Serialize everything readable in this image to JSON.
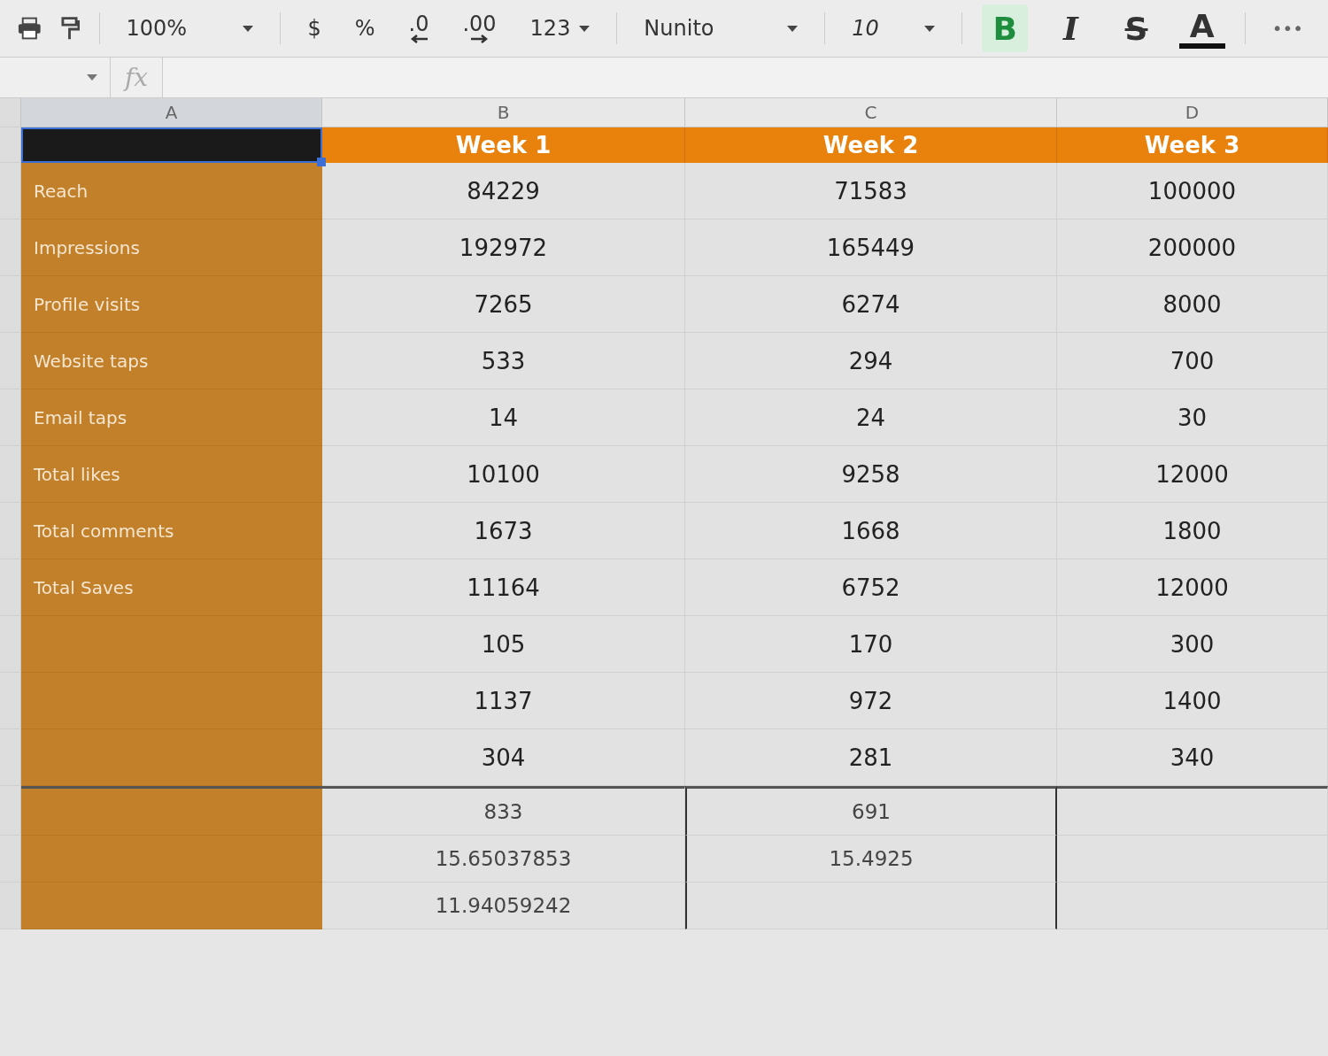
{
  "toolbar": {
    "zoom": "100%",
    "currency": "$",
    "percent": "%",
    "decrease_decimals": ".0",
    "increase_decimals": ".00",
    "more_formats": "123",
    "font": "Nunito",
    "font_size": "10",
    "format_buttons": [
      {
        "kind": "bold",
        "label": "B",
        "selected": true
      },
      {
        "kind": "italic",
        "label": "I",
        "selected": false
      },
      {
        "kind": "strike",
        "label": "S",
        "selected": false
      },
      {
        "kind": "color",
        "label": "A",
        "selected": false
      }
    ],
    "more": "•••"
  },
  "formula_bar": {
    "fx": "fx"
  },
  "columns": [
    "A",
    "B",
    "C",
    "D"
  ],
  "header_row": [
    "Week 1",
    "Week 2",
    "Week 3"
  ],
  "rows": [
    {
      "label": "Reach",
      "values": [
        "84229",
        "71583",
        "100000"
      ]
    },
    {
      "label": "Impressions",
      "values": [
        "192972",
        "165449",
        "200000"
      ]
    },
    {
      "label": "Profile visits",
      "values": [
        "7265",
        "6274",
        "8000"
      ]
    },
    {
      "label": "Website taps",
      "values": [
        "533",
        "294",
        "700"
      ]
    },
    {
      "label": "Email taps",
      "values": [
        "14",
        "24",
        "30"
      ]
    },
    {
      "label": "Total likes",
      "values": [
        "10100",
        "9258",
        "12000"
      ]
    },
    {
      "label": "Total comments",
      "values": [
        "1673",
        "1668",
        "1800"
      ]
    },
    {
      "label": "Total Saves",
      "values": [
        "11164",
        "6752",
        "12000"
      ]
    },
    {
      "values": [
        "105",
        "170",
        "300"
      ]
    },
    {
      "values": [
        "1137",
        "972",
        "1400"
      ]
    },
    {
      "values": [
        "304",
        "281",
        "340"
      ]
    }
  ],
  "summary_rows": [
    {
      "values": [
        "833",
        "691"
      ]
    },
    {
      "values": [
        "15.65037853",
        "15.4925"
      ]
    },
    {
      "values": [
        "11.94059242"
      ]
    }
  ]
}
